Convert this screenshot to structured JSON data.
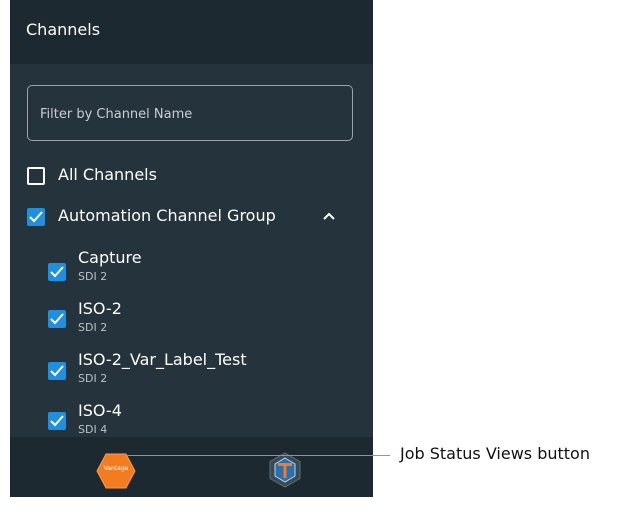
{
  "panel": {
    "title": "Channels",
    "filter": {
      "placeholder": "Filter by Channel Name",
      "value": ""
    },
    "all_channels": {
      "label": "All Channels",
      "checked": false
    },
    "group": {
      "label": "Automation Channel Group",
      "checked": true,
      "expanded": true
    },
    "channels": [
      {
        "name": "Capture",
        "source": "SDI 2",
        "checked": true
      },
      {
        "name": "ISO-2",
        "source": "SDI 2",
        "checked": true
      },
      {
        "name": "ISO-2_Var_Label_Test",
        "source": "SDI 2",
        "checked": true
      },
      {
        "name": "ISO-4",
        "source": "SDI 4",
        "checked": true
      }
    ]
  },
  "footer": {
    "vantage_button": {
      "icon": "vantage-hexagon-icon",
      "text": "Vantage"
    },
    "t_button": {
      "icon": "t-hexagon-icon"
    }
  },
  "callout": {
    "label": "Job Status Views button"
  },
  "colors": {
    "panel_bg": "#25333d",
    "header_bg": "#1c2930",
    "checkbox_checked": "#1f8fe0",
    "vantage_orange": "#f47c20",
    "callout_line": "#f47c20"
  }
}
